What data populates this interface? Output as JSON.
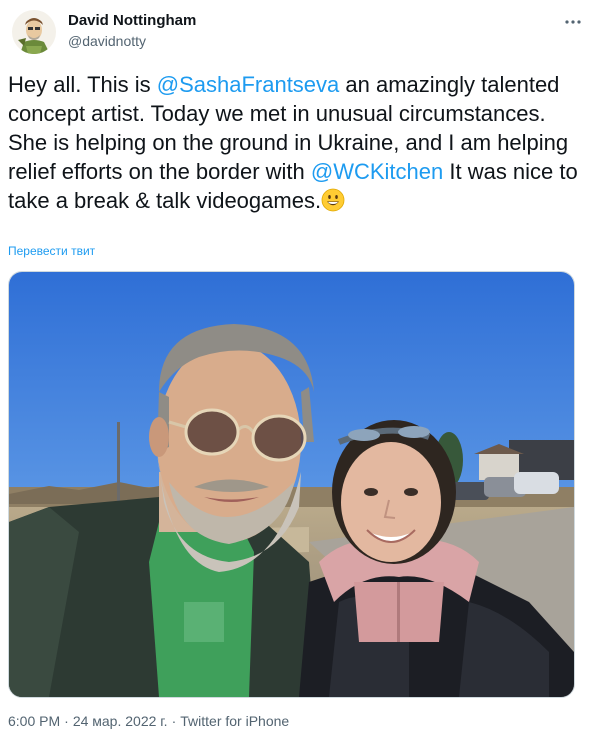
{
  "author": {
    "name": "David Nottingham",
    "handle": "@davidnotty",
    "avatar_icon": "cartoon-avatar-icon"
  },
  "more_icon": "more-horizontal-icon",
  "tweet": {
    "text_1": "Hey all. This is ",
    "mention_1": "@SashaFrantseva",
    "text_2": " an amazingly talented concept artist. Today we met in unusual circumstances.  She is helping on the ground in Ukraine, and I am helping relief efforts on the border with ",
    "mention_2": "@WCKitchen",
    "text_3": " It was nice to take a break & talk videogames.",
    "emoji": "grinning-face-emoji",
    "translate_label": "Перевести твит"
  },
  "media": {
    "type": "photo",
    "icon": "selfie-photo"
  },
  "meta": {
    "time": "6:00 PM",
    "separator": "·",
    "date": "24 мар. 2022 г.",
    "source": "Twitter for iPhone"
  },
  "colors": {
    "link": "#1d9bf0",
    "secondary_text": "#536471",
    "primary_text": "#0f1419",
    "border": "#cfd9de"
  }
}
